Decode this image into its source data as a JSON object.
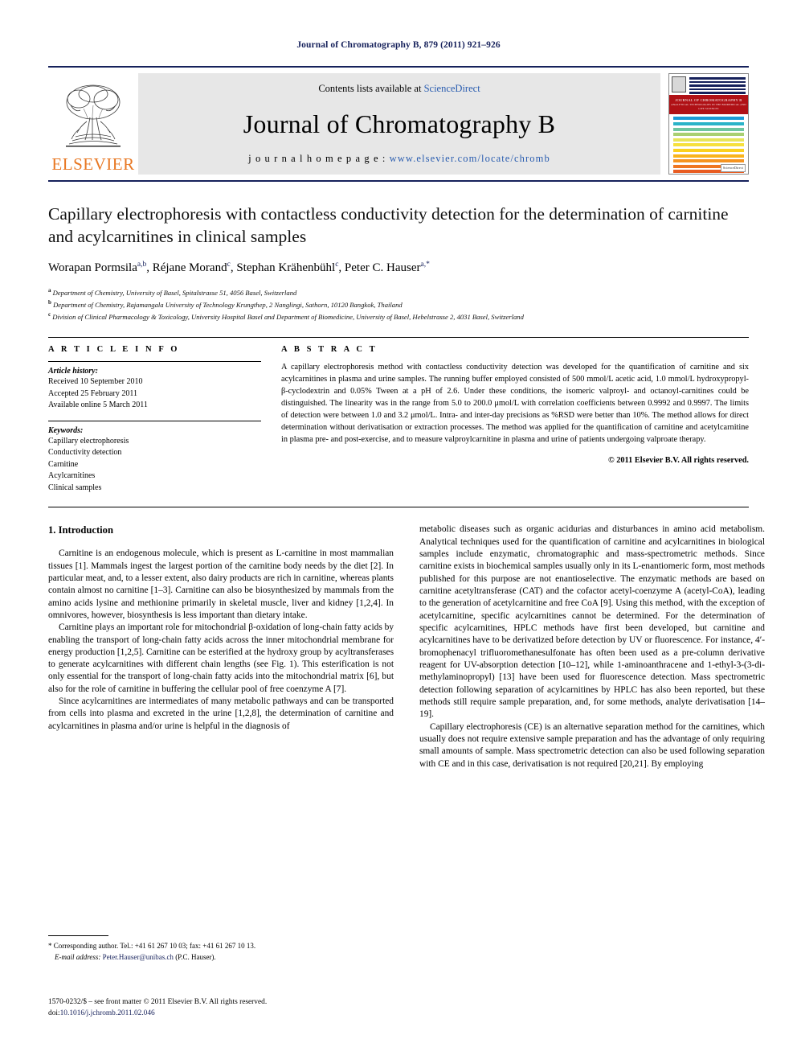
{
  "running_head": "Journal of Chromatography B, 879 (2011) 921–926",
  "masthead": {
    "contents_prefix": "Contents lists available at ",
    "contents_link": "ScienceDirect",
    "journal_title": "Journal of Chromatography B",
    "homepage_prefix": "j o u r n a l   h o m e p a g e :   ",
    "homepage_url": "www.elsevier.com/locate/chromb",
    "publisher": "ELSEVIER",
    "cover": {
      "band_title": "JOURNAL OF CHROMATOGRAPHY B",
      "band_subtitle": "ANALYTICAL TECHNOLOGIES IN THE BIOMEDICAL AND LIFE SCIENCES",
      "footer": "Available online at\nScienceDirect"
    },
    "accent_blue": "#16215b",
    "link_blue": "#2a5db0",
    "elsevier_orange": "#e87722"
  },
  "article": {
    "title": "Capillary electrophoresis with contactless conductivity detection for the determination of carnitine and acylcarnitines in clinical samples",
    "authors": [
      {
        "name": "Worapan Pormsila",
        "marks": "a,b"
      },
      {
        "name": "Réjane Morand",
        "marks": "c"
      },
      {
        "name": "Stephan Krähenbühl",
        "marks": "c"
      },
      {
        "name": "Peter C. Hauser",
        "marks": "a,*"
      }
    ],
    "affiliations": [
      {
        "mark": "a",
        "text": "Department of Chemistry, University of Basel, Spitalstrasse 51, 4056 Basel, Switzerland"
      },
      {
        "mark": "b",
        "text": "Department of Chemistry, Rajamangala University of Technology Krungthep, 2 Nanglingi, Sathorn, 10120 Bangkok, Thailand"
      },
      {
        "mark": "c",
        "text": "Division of Clinical Pharmacology & Toxicology, University Hospital Basel and Department of Biomedicine, University of Basel, Hebelstrasse 2, 4031 Basel, Switzerland"
      }
    ]
  },
  "article_info": {
    "section_label": "A R T I C L E  I N F O",
    "history_label": "Article history:",
    "history": [
      "Received 10 September 2010",
      "Accepted 25 February 2011",
      "Available online 5 March 2011"
    ],
    "keywords_label": "Keywords:",
    "keywords": [
      "Capillary electrophoresis",
      "Conductivity detection",
      "Carnitine",
      "Acylcarnitines",
      "Clinical samples"
    ]
  },
  "abstract": {
    "section_label": "A B S T R A C T",
    "text": "A capillary electrophoresis method with contactless conductivity detection was developed for the quantification of carnitine and six acylcarnitines in plasma and urine samples. The running buffer employed consisted of 500 mmol/L acetic acid, 1.0 mmol/L hydroxypropyl-β-cyclodextrin and 0.05% Tween at a pH of 2.6. Under these conditions, the isomeric valproyl- and octanoyl-carnitines could be distinguished. The linearity was in the range from 5.0 to 200.0 μmol/L with correlation coefficients between 0.9992 and 0.9997. The limits of detection were between 1.0 and 3.2 μmol/L. Intra- and inter-day precisions as %RSD were better than 10%. The method allows for direct determination without derivatisation or extraction processes. The method was applied for the quantification of carnitine and acetylcarnitine in plasma pre- and post-exercise, and to measure valproylcarnitine in plasma and urine of patients undergoing valproate therapy.",
    "copyright": "© 2011 Elsevier B.V. All rights reserved."
  },
  "body": {
    "section_number_title": "1.  Introduction",
    "left_paragraphs": [
      "Carnitine is an endogenous molecule, which is present as L-carnitine in most mammalian tissues [1]. Mammals ingest the largest portion of the carnitine body needs by the diet [2]. In particular meat, and, to a lesser extent, also dairy products are rich in carnitine, whereas plants contain almost no carnitine [1–3]. Carnitine can also be biosynthesized by mammals from the amino acids lysine and methionine primarily in skeletal muscle, liver and kidney [1,2,4]. In omnivores, however, biosynthesis is less important than dietary intake.",
      "Carnitine plays an important role for mitochondrial β-oxidation of long-chain fatty acids by enabling the transport of long-chain fatty acids across the inner mitochondrial membrane for energy production [1,2,5]. Carnitine can be esterified at the hydroxy group by acyltransferases to generate acylcarnitines with different chain lengths (see Fig. 1). This esterification is not only essential for the transport of long-chain fatty acids into the mitochondrial matrix [6], but also for the role of carnitine in buffering the cellular pool of free coenzyme A [7].",
      "Since acylcarnitines are intermediates of many metabolic pathways and can be transported from cells into plasma and excreted in the urine [1,2,8], the determination of carnitine and acylcarnitines in plasma and/or urine is helpful in the diagnosis of"
    ],
    "right_paragraphs": [
      "metabolic diseases such as organic acidurias and disturbances in amino acid metabolism. Analytical techniques used for the quantification of carnitine and acylcarnitines in biological samples include enzymatic, chromatographic and mass-spectrometric methods. Since carnitine exists in biochemical samples usually only in its L-enantiomeric form, most methods published for this purpose are not enantioselective. The enzymatic methods are based on carnitine acetyltransferase (CAT) and the cofactor acetyl-coenzyme A (acetyl-CoA), leading to the generation of acetylcarnitine and free CoA [9]. Using this method, with the exception of acetylcarnitine, specific acylcarnitines cannot be determined. For the determination of specific acylcarnitines, HPLC methods have first been developed, but carnitine and acylcarnitines have to be derivatized before detection by UV or fluorescence. For instance, 4′-bromophenacyl trifluoromethanesulfonate has often been used as a pre-column derivative reagent for UV-absorption detection [10–12], while 1-aminoanthracene and 1-ethyl-3-(3-di-methylaminopropyl) [13] have been used for fluorescence detection. Mass spectrometric detection following separation of acylcarnitines by HPLC has also been reported, but these methods still require sample preparation, and, for some methods, analyte derivatisation [14–19].",
      "Capillary electrophoresis (CE) is an alternative separation method for the carnitines, which usually does not require extensive sample preparation and has the advantage of only requiring small amounts of sample. Mass spectrometric detection can also be used following separation with CE and in this case, derivatisation is not required [20,21]. By employing"
    ]
  },
  "footnotes": {
    "corresponding": "* Corresponding author. Tel.: +41 61 267 10 03; fax: +41 61 267 10 13.",
    "email_label": "E-mail address:",
    "email": "Peter.Hauser@unibas.ch",
    "email_suffix": "(P.C. Hauser)."
  },
  "imprint": {
    "line1": "1570-0232/$ – see front matter © 2011 Elsevier B.V. All rights reserved.",
    "doi_label": "doi:",
    "doi": "10.1016/j.jchromb.2011.02.046"
  }
}
